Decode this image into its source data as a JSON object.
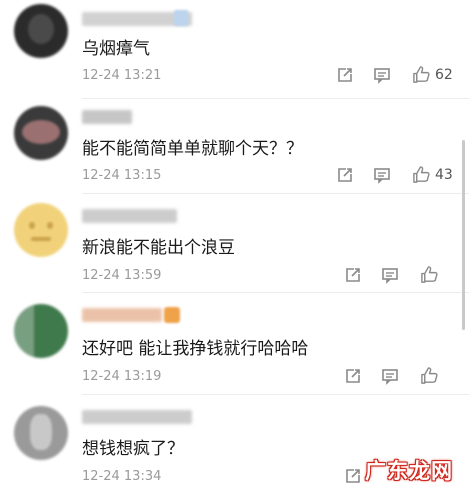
{
  "comments": [
    {
      "text": "乌烟瘴气",
      "time": "12-24 13:21",
      "likes": "62",
      "avatar_color": "#2b2b2b",
      "avatar_accent": "#4a4a4a",
      "name_color": "#c9c9c9"
    },
    {
      "text": "能不能简简单单就聊个天？？",
      "time": "12-24 13:15",
      "likes": "43",
      "avatar_color": "#3a3a3a",
      "avatar_accent": "#9a7070",
      "name_color": "#bdbdbd"
    },
    {
      "text": "新浪能不能出个浪豆",
      "time": "12-24 13:59",
      "likes": "",
      "avatar_color": "#f1d27a",
      "avatar_accent": "#c9a04a",
      "name_color": "#c4c4c4"
    },
    {
      "text": "还好吧 能让我挣钱就行哈哈哈",
      "time": "12-24 13:19",
      "likes": "",
      "avatar_color": "#3f7a4c",
      "avatar_accent": "#e6e6e6",
      "name_color": "#e8b89a"
    },
    {
      "text": "想钱想疯了？",
      "time": "12-24 13:34",
      "likes": "",
      "avatar_color": "#9a9a9a",
      "avatar_accent": "#dcdcdc",
      "name_color": "#c4c4c4"
    }
  ],
  "icons": {
    "share": "share-icon",
    "comment": "comment-icon",
    "like": "thumbs-up-icon"
  },
  "colors": {
    "icon_gray": "#8a8a8a",
    "watermark": "#d8291f"
  }
}
